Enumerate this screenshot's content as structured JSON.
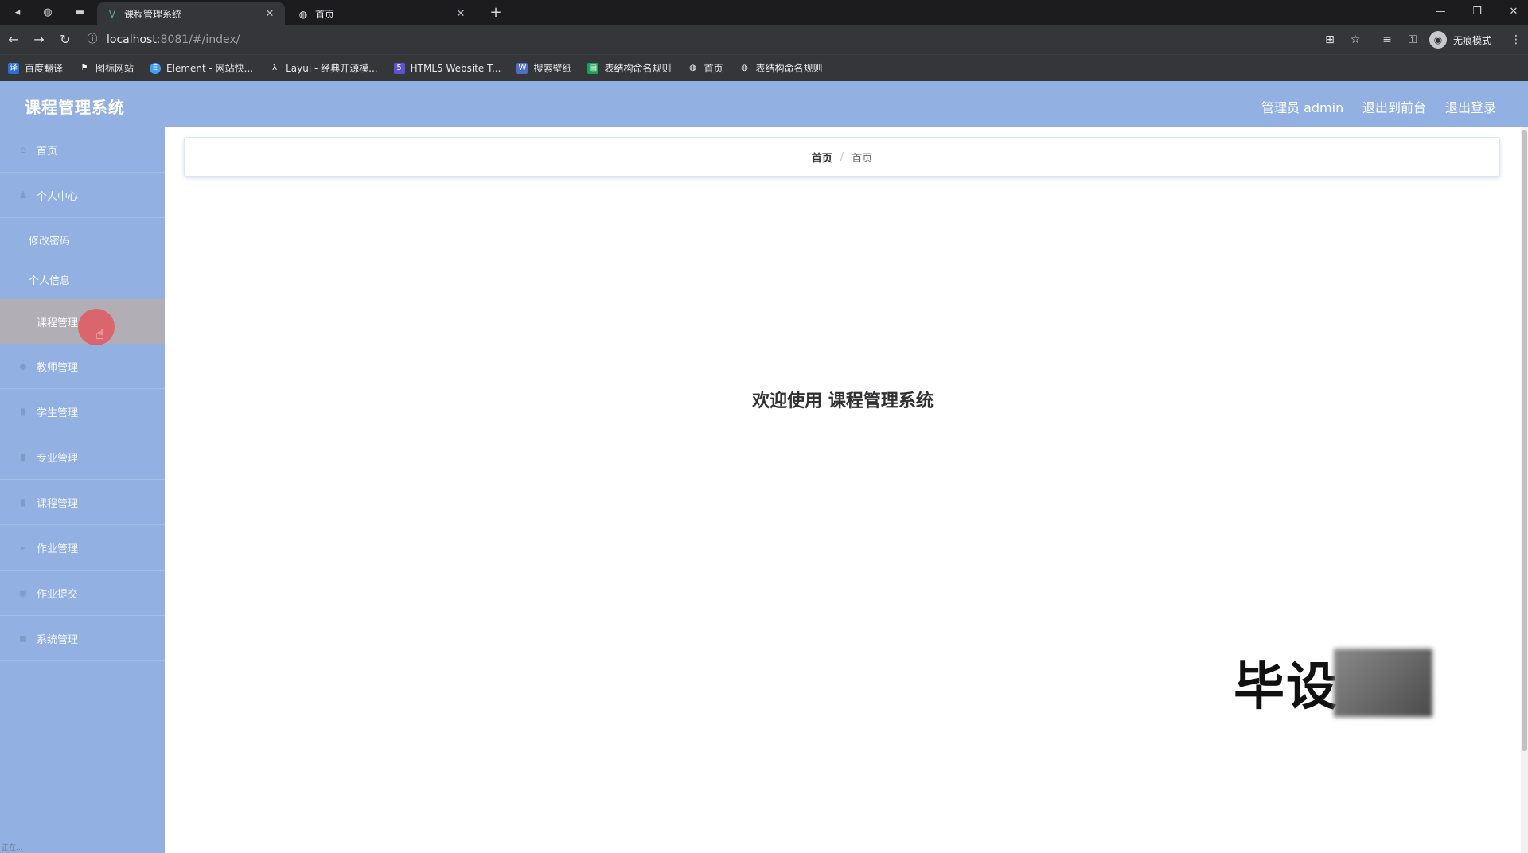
{
  "browser": {
    "tabs": [
      {
        "title": "课程管理系统",
        "icon": "vue-icon",
        "active": true
      },
      {
        "title": "首页",
        "icon": "globe-icon",
        "active": false
      }
    ],
    "url_host": "localhost",
    "url_path": ":8081/#/index/",
    "incognito_label": "无痕模式",
    "bookmarks": [
      {
        "label": "百度翻译",
        "icon": "baidu-translate-icon"
      },
      {
        "label": "图标网站",
        "icon": "flag-icon"
      },
      {
        "label": "Element - 网站快...",
        "icon": "element-icon"
      },
      {
        "label": "Layui - 经典开源模...",
        "icon": "layui-icon"
      },
      {
        "label": "HTML5 Website T...",
        "icon": "html5-icon"
      },
      {
        "label": "搜索壁纸",
        "icon": "wallpaper-icon"
      },
      {
        "label": "表结构命名规则",
        "icon": "green-doc-icon"
      },
      {
        "label": "首页",
        "icon": "globe-icon"
      },
      {
        "label": "表结构命名规则",
        "icon": "globe-icon"
      }
    ]
  },
  "app": {
    "title": "课程管理系统",
    "header_links": [
      "管理员 admin",
      "退出到前台",
      "退出登录"
    ],
    "menu": [
      {
        "label": "首页",
        "icon": "home-icon"
      },
      {
        "label": "个人中心",
        "icon": "user-icon"
      }
    ],
    "submenu": [
      {
        "label": "修改密码"
      },
      {
        "label": "个人信息"
      },
      {
        "label": "课程管理"
      }
    ],
    "menu_more": [
      {
        "label": "教师管理",
        "icon": "teacher-icon"
      },
      {
        "label": "学生管理",
        "icon": "student-icon"
      },
      {
        "label": "专业管理",
        "icon": "major-icon"
      },
      {
        "label": "课程管理",
        "icon": "course-icon"
      },
      {
        "label": "作业管理",
        "icon": "task-icon"
      },
      {
        "label": "作业提交",
        "icon": "submit-icon"
      },
      {
        "label": "系统管理",
        "icon": "settings-icon"
      }
    ],
    "breadcrumb": {
      "home": "首页",
      "current": "首页"
    },
    "welcome": "欢迎使用 课程管理系统"
  },
  "watermark": "毕设",
  "status_text": "正在..."
}
